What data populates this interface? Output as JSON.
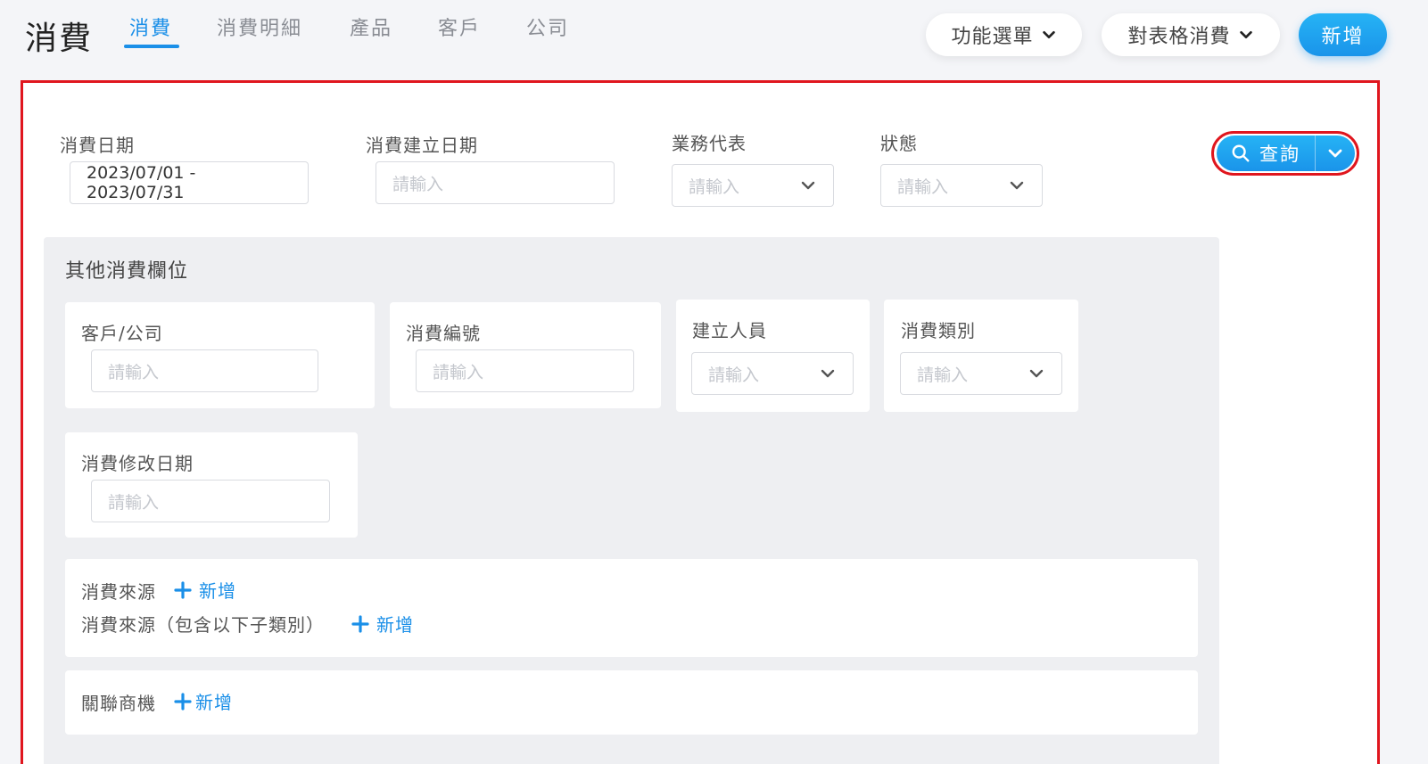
{
  "header": {
    "title": "消費",
    "tabs": [
      {
        "label": "消費",
        "active": true
      },
      {
        "label": "消費明細",
        "active": false
      },
      {
        "label": "產品",
        "active": false
      },
      {
        "label": "客戶",
        "active": false
      },
      {
        "label": "公司",
        "active": false
      }
    ],
    "function_menu_label": "功能選單",
    "table_action_label": "對表格消費",
    "new_label": "新增"
  },
  "filters": {
    "date": {
      "label": "消費日期",
      "value": "2023/07/01 - 2023/07/31"
    },
    "created_date": {
      "label": "消費建立日期",
      "placeholder": "請輸入"
    },
    "sales_rep": {
      "label": "業務代表",
      "placeholder": "請輸入"
    },
    "status": {
      "label": "狀態",
      "placeholder": "請輸入"
    },
    "search_label": "查詢"
  },
  "other_fields": {
    "title": "其他消費欄位",
    "customer": {
      "label": "客戶/公司",
      "placeholder": "請輸入"
    },
    "number": {
      "label": "消費編號",
      "placeholder": "請輸入"
    },
    "creator": {
      "label": "建立人員",
      "placeholder": "請輸入"
    },
    "category": {
      "label": "消費類別",
      "placeholder": "請輸入"
    },
    "modified_date": {
      "label": "消費修改日期",
      "placeholder": "請輸入"
    },
    "source": {
      "label": "消費來源",
      "add_label": "新增"
    },
    "source_sub": {
      "label": "消費來源（包含以下子類別）",
      "add_label": "新增"
    },
    "opportunity": {
      "label": "關聯商機",
      "add_label": "新增"
    }
  },
  "colors": {
    "accent": "#1a8fe8",
    "highlight": "#e0161e"
  }
}
